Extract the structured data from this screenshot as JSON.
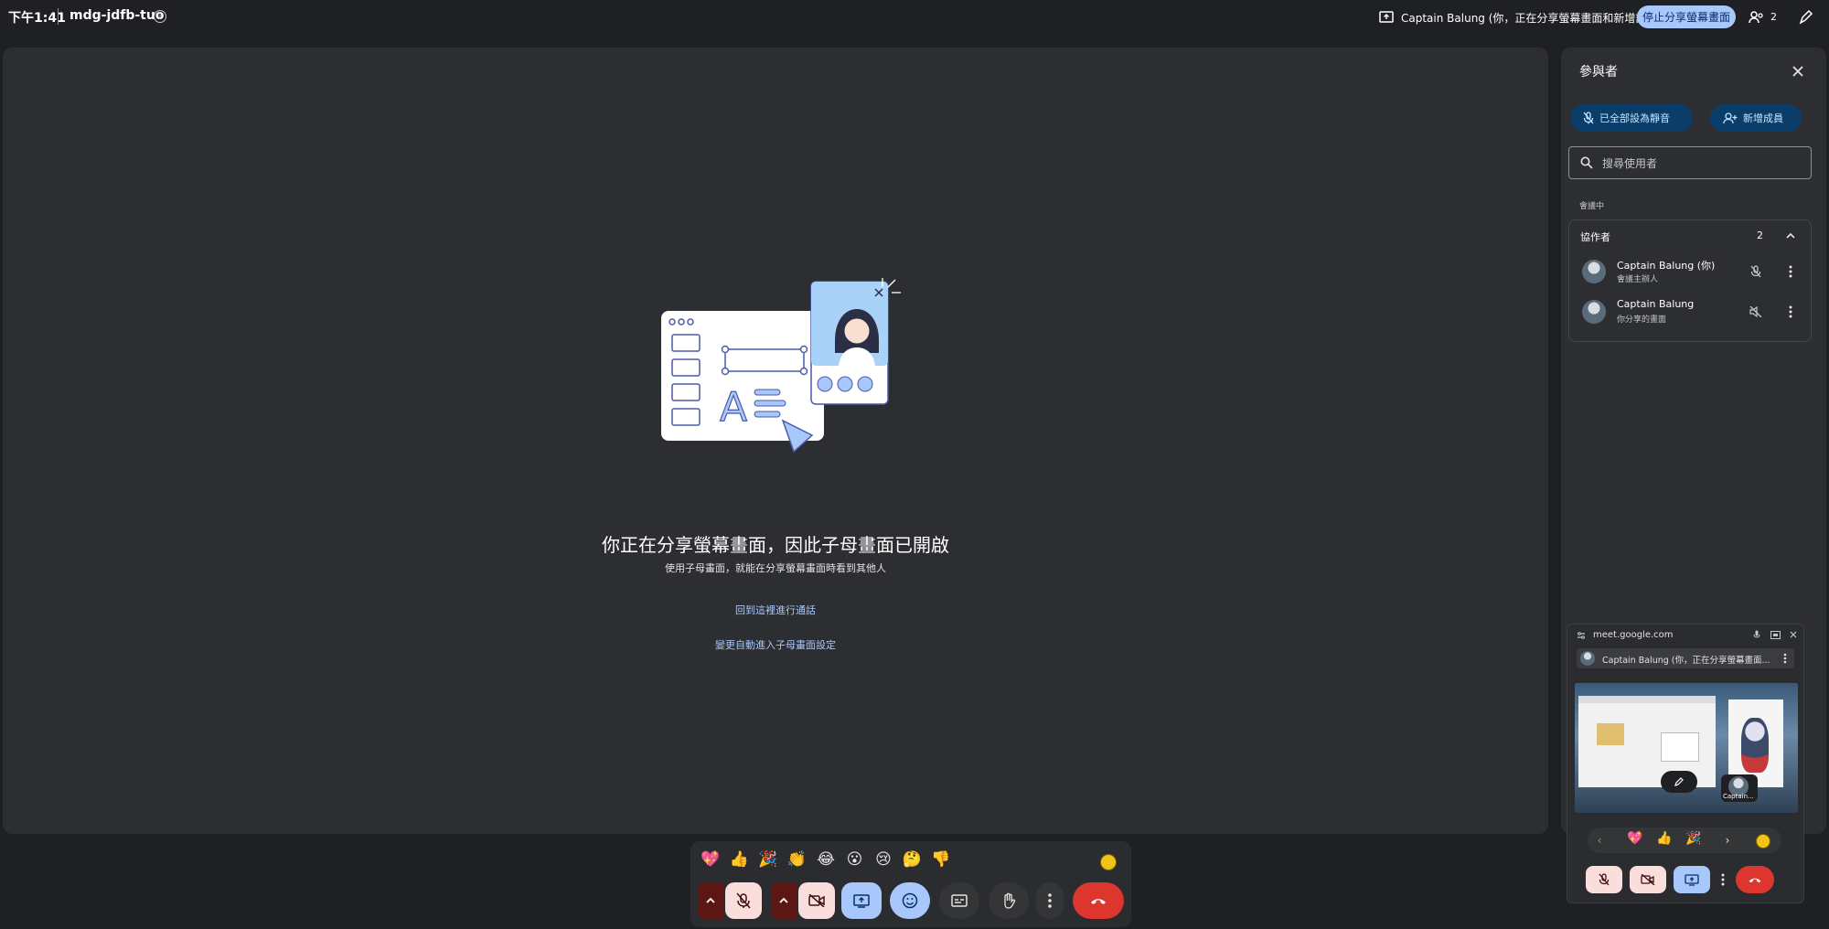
{
  "topbar": {
    "time": "下午1:41",
    "meeting_code": "mdg-jdfb-tuo",
    "info_icon": "info-icon",
    "share_status": "Captain Balung (你，正在分享螢幕畫面和新增註解)",
    "stop_share_label": "停止分享螢幕畫面",
    "people_count": "2"
  },
  "stage": {
    "title": "你正在分享螢幕畫面，因此子母畫面已開啟",
    "subtitle": "使用子母畫面，就能在分享螢幕畫面時看到其他人",
    "link_return": "回到這裡進行通話",
    "link_settings": "變更自動進入子母畫面設定"
  },
  "reactions": [
    "💖",
    "👍",
    "🎉",
    "👏",
    "😂",
    "😮",
    "😢",
    "🤔",
    "👎"
  ],
  "panel": {
    "title": "參與者",
    "mute_all_label": "已全部設為靜音",
    "add_people_label": "新增成員",
    "search_placeholder": "搜尋使用者",
    "section_label": "會議中",
    "group_label": "協作者",
    "group_count": "2",
    "participants": [
      {
        "name": "Captain Balung (你)",
        "role": "會議主辦人"
      },
      {
        "name": "Captain Balung",
        "role": "你分享的畫面"
      }
    ]
  },
  "pip": {
    "domain": "meet.google.com",
    "tile_label": "Captain Balung (你，正在分享螢幕畫面...",
    "thumb_label": "Captain...",
    "reactions": [
      "💖",
      "👍",
      "🎉"
    ]
  },
  "colors": {
    "background": "#1f2023",
    "stage": "#2d2e31",
    "accent": "#a8c7fa",
    "danger": "#dc362e",
    "muted_red": "#f9dedc"
  }
}
